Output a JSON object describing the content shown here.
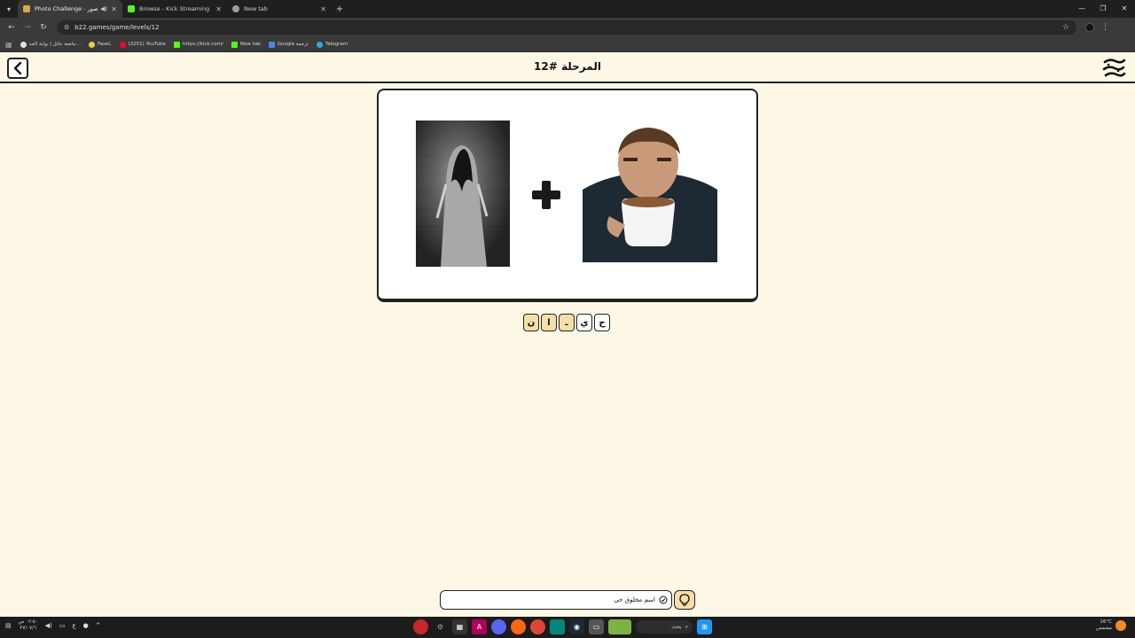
{
  "browser": {
    "tabs": [
      {
        "title": "Photo Challenge - تحدي الصور",
        "favicon_color": "#d9a94a",
        "active": true
      },
      {
        "title": "Browse - Kick Streaming",
        "favicon_color": "#53fc18",
        "active": false
      },
      {
        "title": "New tab",
        "favicon_color": "#9e9e9e",
        "active": false
      }
    ],
    "url": "b22.games/game/levels/12",
    "bookmarks": [
      {
        "label": "جامعة حائل | بوابة الخد...",
        "color": "#e0e0e0"
      },
      {
        "label": "Faselـ",
        "color": "#f2c94c"
      },
      {
        "label": "(3251) YouTube",
        "color": "#ff0033"
      },
      {
        "label": "https://kick.com/",
        "color": "#53fc18"
      },
      {
        "label": "New tab",
        "color": "#53fc18"
      },
      {
        "label": "Google ترجمة",
        "color": "#4285f4"
      },
      {
        "label": "Telegram",
        "color": "#2aabee"
      }
    ]
  },
  "game": {
    "level_title": "المرحلة #12",
    "tiles": [
      {
        "letter": "ن",
        "filled": false
      },
      {
        "letter": "ا",
        "filled": false
      },
      {
        "letter": "ـ",
        "filled": false
      },
      {
        "letter": "ي",
        "filled": true
      },
      {
        "letter": "ح",
        "filled": true
      }
    ],
    "hint_text": "اسم مخلوق حي",
    "accent_color": "#f6dfa6"
  },
  "taskbar": {
    "time": "٠٢:٥٠ ص",
    "date": "٢٧/٠٧/٦",
    "lang": "ع",
    "search_label": "بحث",
    "temperature": "16°C",
    "weather_label": "مشمس"
  }
}
